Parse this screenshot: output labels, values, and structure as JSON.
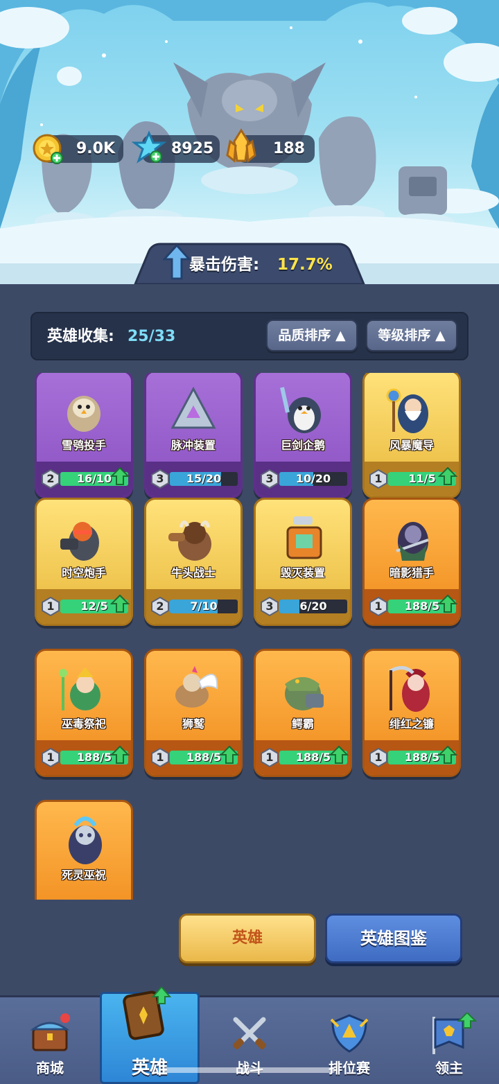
{
  "resources": [
    {
      "name": "gold",
      "value": "9.0K"
    },
    {
      "name": "diamond",
      "value": "8925"
    },
    {
      "name": "crystal",
      "value": "188"
    }
  ],
  "bonus": {
    "label": "暴击伤害:",
    "value": "17.7%"
  },
  "collection": {
    "label": "英雄收集:",
    "count": "25/33"
  },
  "sort_buttons": [
    "品质排序",
    "等级排序"
  ],
  "heroes": [
    {
      "name": "雪鸮投手",
      "rarity": "purple",
      "level": "2",
      "progress": "16/10",
      "fill": 1.0,
      "upgradable": true
    },
    {
      "name": "脉冲装置",
      "rarity": "purple",
      "level": "3",
      "progress": "15/20",
      "fill": 0.75,
      "upgradable": false
    },
    {
      "name": "巨剑企鹅",
      "rarity": "purple",
      "level": "3",
      "progress": "10/20",
      "fill": 0.5,
      "upgradable": false
    },
    {
      "name": "风暴魔导",
      "rarity": "gold",
      "level": "1",
      "progress": "11/5",
      "fill": 1.0,
      "upgradable": true
    },
    {
      "name": "时空炮手",
      "rarity": "gold",
      "level": "1",
      "progress": "12/5",
      "fill": 1.0,
      "upgradable": true
    },
    {
      "name": "牛头战士",
      "rarity": "gold",
      "level": "2",
      "progress": "7/10",
      "fill": 0.7,
      "upgradable": false
    },
    {
      "name": "毁灭装置",
      "rarity": "gold",
      "level": "3",
      "progress": "6/20",
      "fill": 0.3,
      "upgradable": false
    },
    {
      "name": "暗影猎手",
      "rarity": "orange",
      "level": "1",
      "progress": "188/5",
      "fill": 1.0,
      "upgradable": true
    },
    {
      "name": "巫毒祭祀",
      "rarity": "orange",
      "level": "1",
      "progress": "188/5",
      "fill": 1.0,
      "upgradable": true
    },
    {
      "name": "狮鹫",
      "rarity": "orange",
      "level": "1",
      "progress": "188/5",
      "fill": 1.0,
      "upgradable": true
    },
    {
      "name": "鳄霸",
      "rarity": "orange",
      "level": "1",
      "progress": "188/5",
      "fill": 1.0,
      "upgradable": true
    },
    {
      "name": "绯红之镰",
      "rarity": "orange",
      "level": "1",
      "progress": "188/5",
      "fill": 1.0,
      "upgradable": true
    },
    {
      "name": "死灵巫祝",
      "rarity": "orange",
      "level": "",
      "progress": "",
      "fill": 0,
      "upgradable": false
    }
  ],
  "tabs": {
    "hero": "英雄",
    "codex": "英雄图鉴"
  },
  "nav": [
    {
      "label": "商城",
      "icon": "shop-chest-icon",
      "active": false,
      "badge": "red-dot"
    },
    {
      "label": "英雄",
      "icon": "hero-card-icon",
      "active": true,
      "badge": "green-arrow"
    },
    {
      "label": "战斗",
      "icon": "crossed-swords-icon",
      "active": false
    },
    {
      "label": "排位赛",
      "icon": "rank-shield-icon",
      "active": false
    },
    {
      "label": "领主",
      "icon": "lord-banner-icon",
      "active": false,
      "badge": "green-arrow"
    }
  ],
  "colors": {
    "bg": "#3d4a66",
    "crit_value": "#ffe34a",
    "count": "#7fdcf6",
    "bar_green": "#35d27a",
    "bar_blue": "#3aa5d8"
  }
}
